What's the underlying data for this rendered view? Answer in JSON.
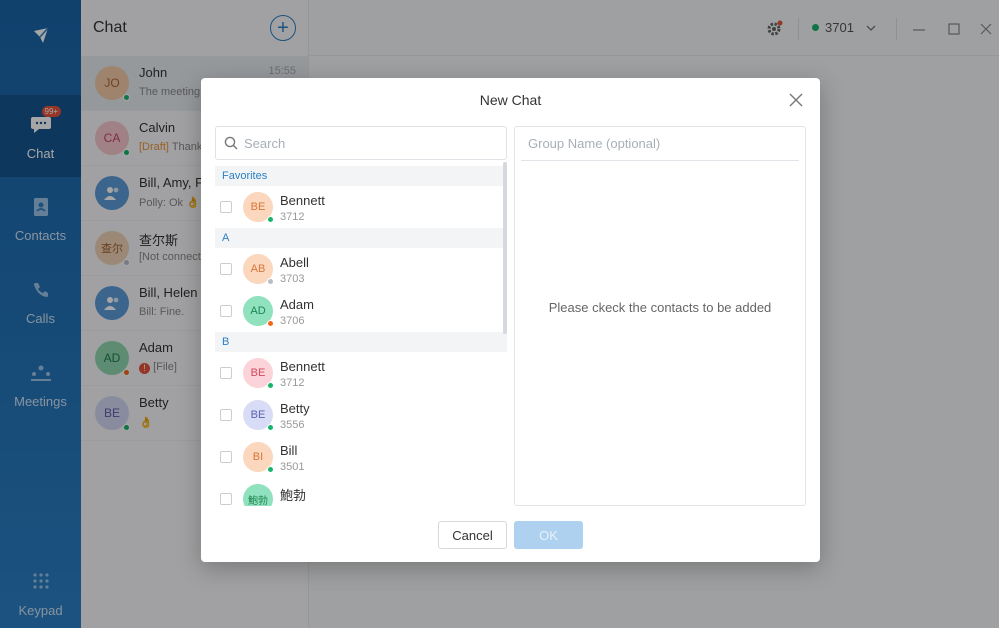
{
  "colors": {
    "brand": "#2b7fc4",
    "online": "#19b36b",
    "offline": "#b8bec6",
    "busy": "#f06a1a"
  },
  "rail": {
    "badge": "99+",
    "items": [
      {
        "label": "Chat",
        "icon": "chat-bubble-icon"
      },
      {
        "label": "Contacts",
        "icon": "contacts-book-icon"
      },
      {
        "label": "Calls",
        "icon": "phone-icon"
      },
      {
        "label": "Meetings",
        "icon": "meeting-people-icon"
      },
      {
        "label": "Keypad",
        "icon": "keypad-icon"
      }
    ]
  },
  "chatlist": {
    "title": "Chat",
    "conversations": [
      {
        "initials": "JO",
        "name": "John",
        "message": "The meeting",
        "time": "15:55"
      },
      {
        "initials": "CA",
        "name": "Calvin",
        "draft": "[Draft]",
        "message": "Thank"
      },
      {
        "initials": "",
        "name": "Bill, Amy, P",
        "message": "Polly: Ok 👌 ,"
      },
      {
        "initials": "查尔",
        "name": "查尔斯",
        "message": "[Not connect"
      },
      {
        "initials": "",
        "name": "Bill, Helen S",
        "message": "Bill: Fine."
      },
      {
        "initials": "AD",
        "name": "Adam",
        "message": "[File]"
      },
      {
        "initials": "BE",
        "name": "Betty",
        "message": "👌"
      }
    ]
  },
  "topbar": {
    "account": "3701"
  },
  "dialog": {
    "title": "New Chat",
    "search_placeholder": "Search",
    "group_placeholder": "Group Name (optional)",
    "hint": "Please ckeck the contacts to be added",
    "cancel_label": "Cancel",
    "ok_label": "OK",
    "sections": [
      {
        "label": "Favorites",
        "contacts": [
          {
            "initials": "BE",
            "name": "Bennett",
            "ext": "3712"
          }
        ]
      },
      {
        "label": "A",
        "contacts": [
          {
            "initials": "AB",
            "name": "Abell",
            "ext": "3703"
          },
          {
            "initials": "AD",
            "name": "Adam",
            "ext": "3706"
          }
        ]
      },
      {
        "label": "B",
        "contacts": [
          {
            "initials": "BE",
            "name": "Bennett",
            "ext": "3712"
          },
          {
            "initials": "BE",
            "name": "Betty",
            "ext": "3556"
          },
          {
            "initials": "BI",
            "name": "Bill",
            "ext": "3501"
          },
          {
            "initials": "鮑勃",
            "name": "鮑勃",
            "ext": ""
          }
        ]
      }
    ]
  }
}
